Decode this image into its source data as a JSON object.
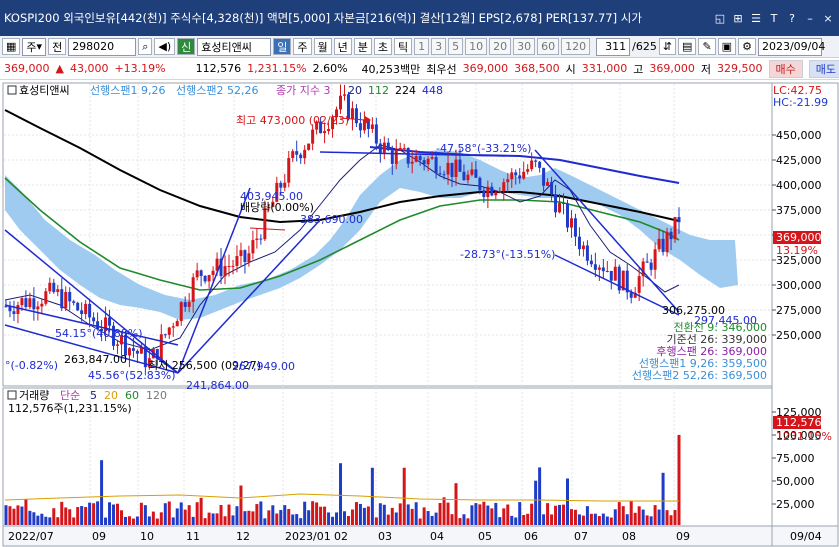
{
  "titlebar": {
    "text": "KOSPI200 외국인보유[442(천)] 주식수[4,328(천)] 액면[5,000] 자본금[216(억)] 결산[12월] EPS[2,678] PER[137.77] 시가",
    "icons": [
      "restore-icon",
      "tile-icon",
      "list-icon",
      "font-size-icon",
      "help-icon",
      "minimize-icon",
      "close-icon"
    ]
  },
  "toolbar": {
    "period_select": "주",
    "prev_label": "전",
    "code": "298020",
    "name_badge": "신",
    "name": "효성티앤씨",
    "periods": [
      "일",
      "주",
      "월",
      "년",
      "분",
      "초",
      "틱"
    ],
    "active_period": "일",
    "intervals": [
      "1",
      "3",
      "5",
      "10",
      "20",
      "30",
      "60",
      "120"
    ],
    "page": "311",
    "total": "/625",
    "date": "2023/09/04"
  },
  "quote": {
    "price": "369,000",
    "change": "43,000",
    "change_pct": "+13.19%",
    "volume": "112,576",
    "volume_pct": "1,231.15%",
    "turnover": "2.60%",
    "amount": "40,253백만",
    "best_ask_label": "최우선",
    "best_ask": "369,000",
    "best_bid": "368,500",
    "open_label": "시",
    "open": "331,000",
    "high_label": "고",
    "high": "369,000",
    "low_label": "저",
    "low": "329,500",
    "buy_label": "매수",
    "sell_label": "매도"
  },
  "price_legend": {
    "name": "효성티앤씨",
    "senkou_a": "선행스팬1 9,26",
    "senkou_b": "선행스팬2 52,26",
    "ma_label": "종가 지수 3",
    "ma_periods": [
      "20",
      "112",
      "224",
      "448"
    ]
  },
  "lc_hc": {
    "lc": "LC:42.75",
    "hc": "HC:-21.99"
  },
  "annotations": {
    "high": "최고 473,000 (02/23)",
    "angle1": "-47.58°(-33.21%)",
    "angle2": "-28.73°(-13.51%)",
    "angle3": "54.15°(40.88%)",
    "angle4": "45.56°(52.83%)",
    "angle5": "°(-0.82%)",
    "div_label": "배당락(0.00%)",
    "p403945": "403,945.00",
    "p383690": "383,690.00",
    "p263847": "263,847.00",
    "p241864": "241,864.00",
    "low_mark": "최저 256,500 (09/27)",
    "p267949": "267,949.00",
    "p306275": "306,275.00",
    "p297445": "297,445.00"
  },
  "ichimoku": {
    "conversion": "전환선 9: 346,000",
    "base": "기준선 26: 339,000",
    "lagging": "후행스팬 26: 369,000",
    "span1": "선행스팬1 9,26: 359,500",
    "span2": "선행스팬2 52,26: 369,500"
  },
  "price_axis": {
    "ticks": [
      "450,000",
      "425,000",
      "400,000",
      "375,000",
      "350,000",
      "325,000",
      "300,000",
      "275,000",
      "250,000"
    ],
    "current": "369,000",
    "current_pct": "13.19%"
  },
  "volume_legend": {
    "title": "거래량",
    "mode": "단순",
    "ma_periods": [
      "5",
      "20",
      "60",
      "120"
    ],
    "current": "112,576주(1,231.15%)"
  },
  "volume_axis": {
    "ticks": [
      "125,000",
      "100,000",
      "75,000",
      "50,000",
      "25,000"
    ],
    "current": "112,576",
    "current_pct": "1231.15%"
  },
  "time_axis": {
    "labels": [
      "2022/07",
      "09",
      "10",
      "11",
      "12",
      "2023/01",
      "02",
      "03",
      "04",
      "05",
      "06",
      "07",
      "08",
      "09"
    ],
    "right_label": "09/04"
  },
  "colors": {
    "up": "#d4161b",
    "down": "#1f3cc7",
    "cloud": "#8ec2ef",
    "ma20": "#1a1f7a",
    "ma112": "#1f8a2a",
    "ma224": "#000000",
    "ma448": "#1f2bd0",
    "titlebar": "#1f3f7a"
  },
  "chart_data": {
    "type": "candlestick+volume",
    "x": [
      "2022/07",
      "09",
      "10",
      "11",
      "12",
      "2023/01",
      "02",
      "03",
      "04",
      "05",
      "06",
      "07",
      "08",
      "09"
    ],
    "price_range": [
      245000,
      475000
    ],
    "close_path": [
      [
        "2022/07",
        305000
      ],
      [
        "08",
        315000
      ],
      [
        "09",
        290000
      ],
      [
        "10",
        262000
      ],
      [
        "11",
        330000
      ],
      [
        "12",
        340000
      ],
      [
        "2023/01",
        420000
      ],
      [
        "02",
        460000
      ],
      [
        "03",
        420000
      ],
      [
        "04",
        415000
      ],
      [
        "05",
        395000
      ],
      [
        "06",
        412000
      ],
      [
        "07",
        350000
      ],
      [
        "08",
        318000
      ],
      [
        "09",
        369000
      ]
    ],
    "volume_range": [
      0,
      140000
    ],
    "last_volume": 112576
  }
}
